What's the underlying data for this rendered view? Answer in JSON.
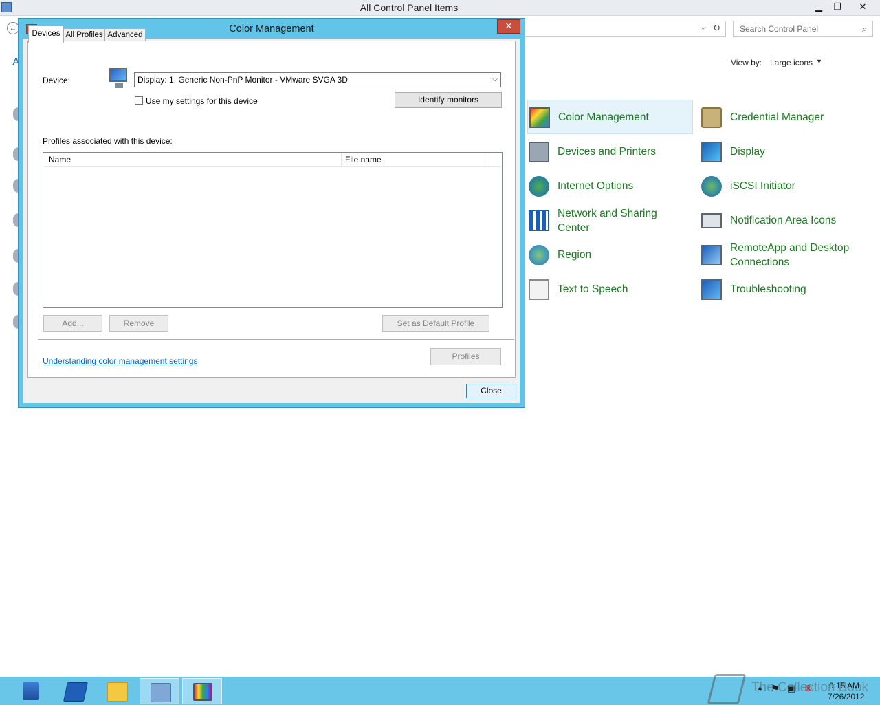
{
  "main_window": {
    "title": "All Control Panel Items",
    "minimize": "▁",
    "restore": "❐",
    "close": "✕",
    "search_placeholder": "Search Control Panel",
    "view_by_label": "View by:",
    "view_by_value": "Large icons",
    "left_strip_letter": "A"
  },
  "control_panel_items": [
    {
      "label": "Color Management",
      "icon": "color-management-icon",
      "selected": true
    },
    {
      "label": "Credential Manager",
      "icon": "credential-manager-icon"
    },
    {
      "label": "Devices and Printers",
      "icon": "devices-printers-icon"
    },
    {
      "label": "Display",
      "icon": "display-icon"
    },
    {
      "label": "Internet Options",
      "icon": "internet-options-icon"
    },
    {
      "label": "iSCSI Initiator",
      "icon": "iscsi-icon"
    },
    {
      "label": "Network and Sharing Center",
      "icon": "network-sharing-icon"
    },
    {
      "label": "Notification Area Icons",
      "icon": "notification-area-icon"
    },
    {
      "label": "Region",
      "icon": "region-icon"
    },
    {
      "label": "RemoteApp and Desktop Connections",
      "icon": "remoteapp-icon"
    },
    {
      "label": "Text to Speech",
      "icon": "text-to-speech-icon"
    },
    {
      "label": "Troubleshooting",
      "icon": "troubleshooting-icon"
    }
  ],
  "dialog": {
    "title": "Color Management",
    "close": "✕",
    "tabs": [
      {
        "label": "Devices",
        "active": true
      },
      {
        "label": "All Profiles"
      },
      {
        "label": "Advanced"
      }
    ],
    "device_label": "Device:",
    "device_value": "Display: 1. Generic Non-PnP Monitor - VMware SVGA 3D",
    "use_settings_label": "Use my settings for this device",
    "identify_button": "Identify monitors",
    "profiles_label": "Profiles associated with this device:",
    "columns": [
      "Name",
      "File name"
    ],
    "add_button": "Add...",
    "remove_button": "Remove",
    "set_default_button": "Set as Default Profile",
    "link": "Understanding color management settings",
    "profiles_button": "Profiles",
    "close_button": "Close"
  },
  "taskbar": {
    "time": "9:15 AM",
    "date": "7/26/2012",
    "watermark": "The Collection Book"
  },
  "colors": {
    "dialog_frame": "#62c4e8",
    "taskbar": "#6ac6e9",
    "item_label": "#1e7a22",
    "link": "#0066cc"
  }
}
